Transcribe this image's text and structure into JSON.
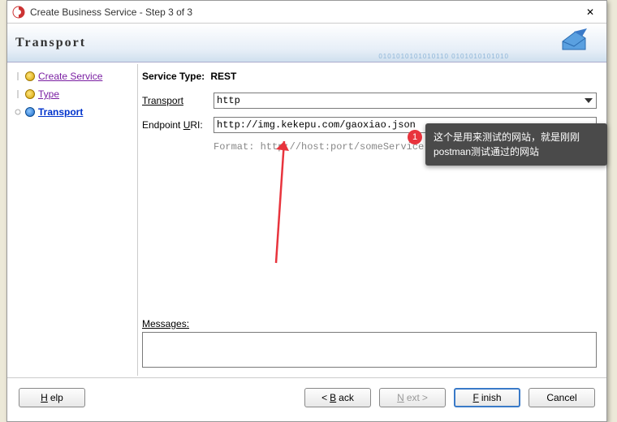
{
  "titlebar": {
    "title": "Create Business Service - Step 3 of 3",
    "close": "✕"
  },
  "banner": {
    "heading": "Transport",
    "bits": "0101010101010110 0101010101010"
  },
  "sidebar": {
    "items": [
      {
        "label": "Create Service",
        "state": "done",
        "dot": "y"
      },
      {
        "label": "Type",
        "state": "done",
        "dot": "y"
      },
      {
        "label": "Transport",
        "state": "cur",
        "dot": "b"
      }
    ]
  },
  "content": {
    "service_type_label": "Service Type:",
    "service_type_value": "REST",
    "transport_label": "Transport",
    "transport_value": "http",
    "endpoint_label_pre": "Endpoint ",
    "endpoint_label_u": "U",
    "endpoint_label_post": "RI:",
    "endpoint_value": "http://img.kekepu.com/gaoxiao.json",
    "format_hint": "Format: http://host:port/someService",
    "messages_label_u": "M",
    "messages_label_post": "essages:"
  },
  "buttons": {
    "help": "Help",
    "help_u": "H",
    "back": " Back",
    "back_u": "B",
    "back_arrow": "<",
    "next": " >",
    "next_u": "N",
    "next_pre": "ext",
    "finish": "inish",
    "finish_u": "F",
    "cancel": "Cancel"
  },
  "callout": {
    "badge": "1",
    "text": "这个是用来测试的网站，就是刚刚postman测试通过的网站"
  }
}
